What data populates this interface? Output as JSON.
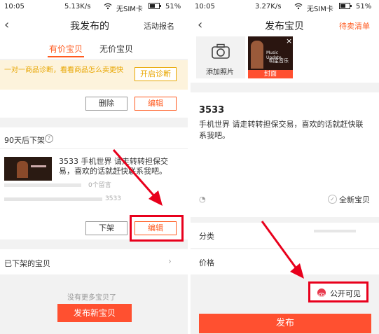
{
  "colors": {
    "accent": "#ff5a1f",
    "annotation": "#e8001c",
    "primary_button": "#ff5030",
    "notice_bg": "#fdf3dc"
  },
  "left": {
    "status": {
      "time": "10:05",
      "speed": "5.13K/s",
      "sim": "无SIM卡",
      "battery": "51%"
    },
    "nav": {
      "title": "我发布的",
      "right_link": "活动报名",
      "back_icon": "chevron-left-icon"
    },
    "tabs": [
      {
        "label": "有价宝贝",
        "active": true
      },
      {
        "label": "无价宝贝",
        "active": false
      }
    ],
    "notice": {
      "text": "一对一商品诊断，看看商品怎么卖更快",
      "button": "开启诊断"
    },
    "card1": {
      "delete_label": "删除",
      "edit_label": "编辑"
    },
    "listing": {
      "header": "90天后下架",
      "help_icon": "question-icon",
      "description": "3533 手机世界 请走转转担保交易，喜欢的话就赶快联系我吧。",
      "comments": "0个留言",
      "price": "3533",
      "delist_label": "下架",
      "edit_label": "编辑"
    },
    "delisted": {
      "label": "已下架的宝贝",
      "chevron": "chevron-right-icon"
    },
    "empty_text": "没有更多宝贝了",
    "publish_new_label": "发布新宝贝"
  },
  "right": {
    "status": {
      "time": "10:05",
      "speed": "3.27K/s",
      "sim": "无SIM卡",
      "battery": "51%"
    },
    "nav": {
      "title": "发布宝贝",
      "right_link": "待卖清单",
      "back_icon": "chevron-left-icon"
    },
    "add_photo_label": "添加照片",
    "photo": {
      "line1": "Music Update",
      "line2": "明星音乐",
      "cover_label": "封面"
    },
    "item_title": "3533",
    "item_desc": "手机世界 请走转转担保交易，喜欢的话就赶快联系我吧。",
    "condition_label": "全新宝贝",
    "category_label": "分类",
    "price_label": "价格",
    "visibility_label": "公开可见",
    "publish_label": "发布"
  }
}
